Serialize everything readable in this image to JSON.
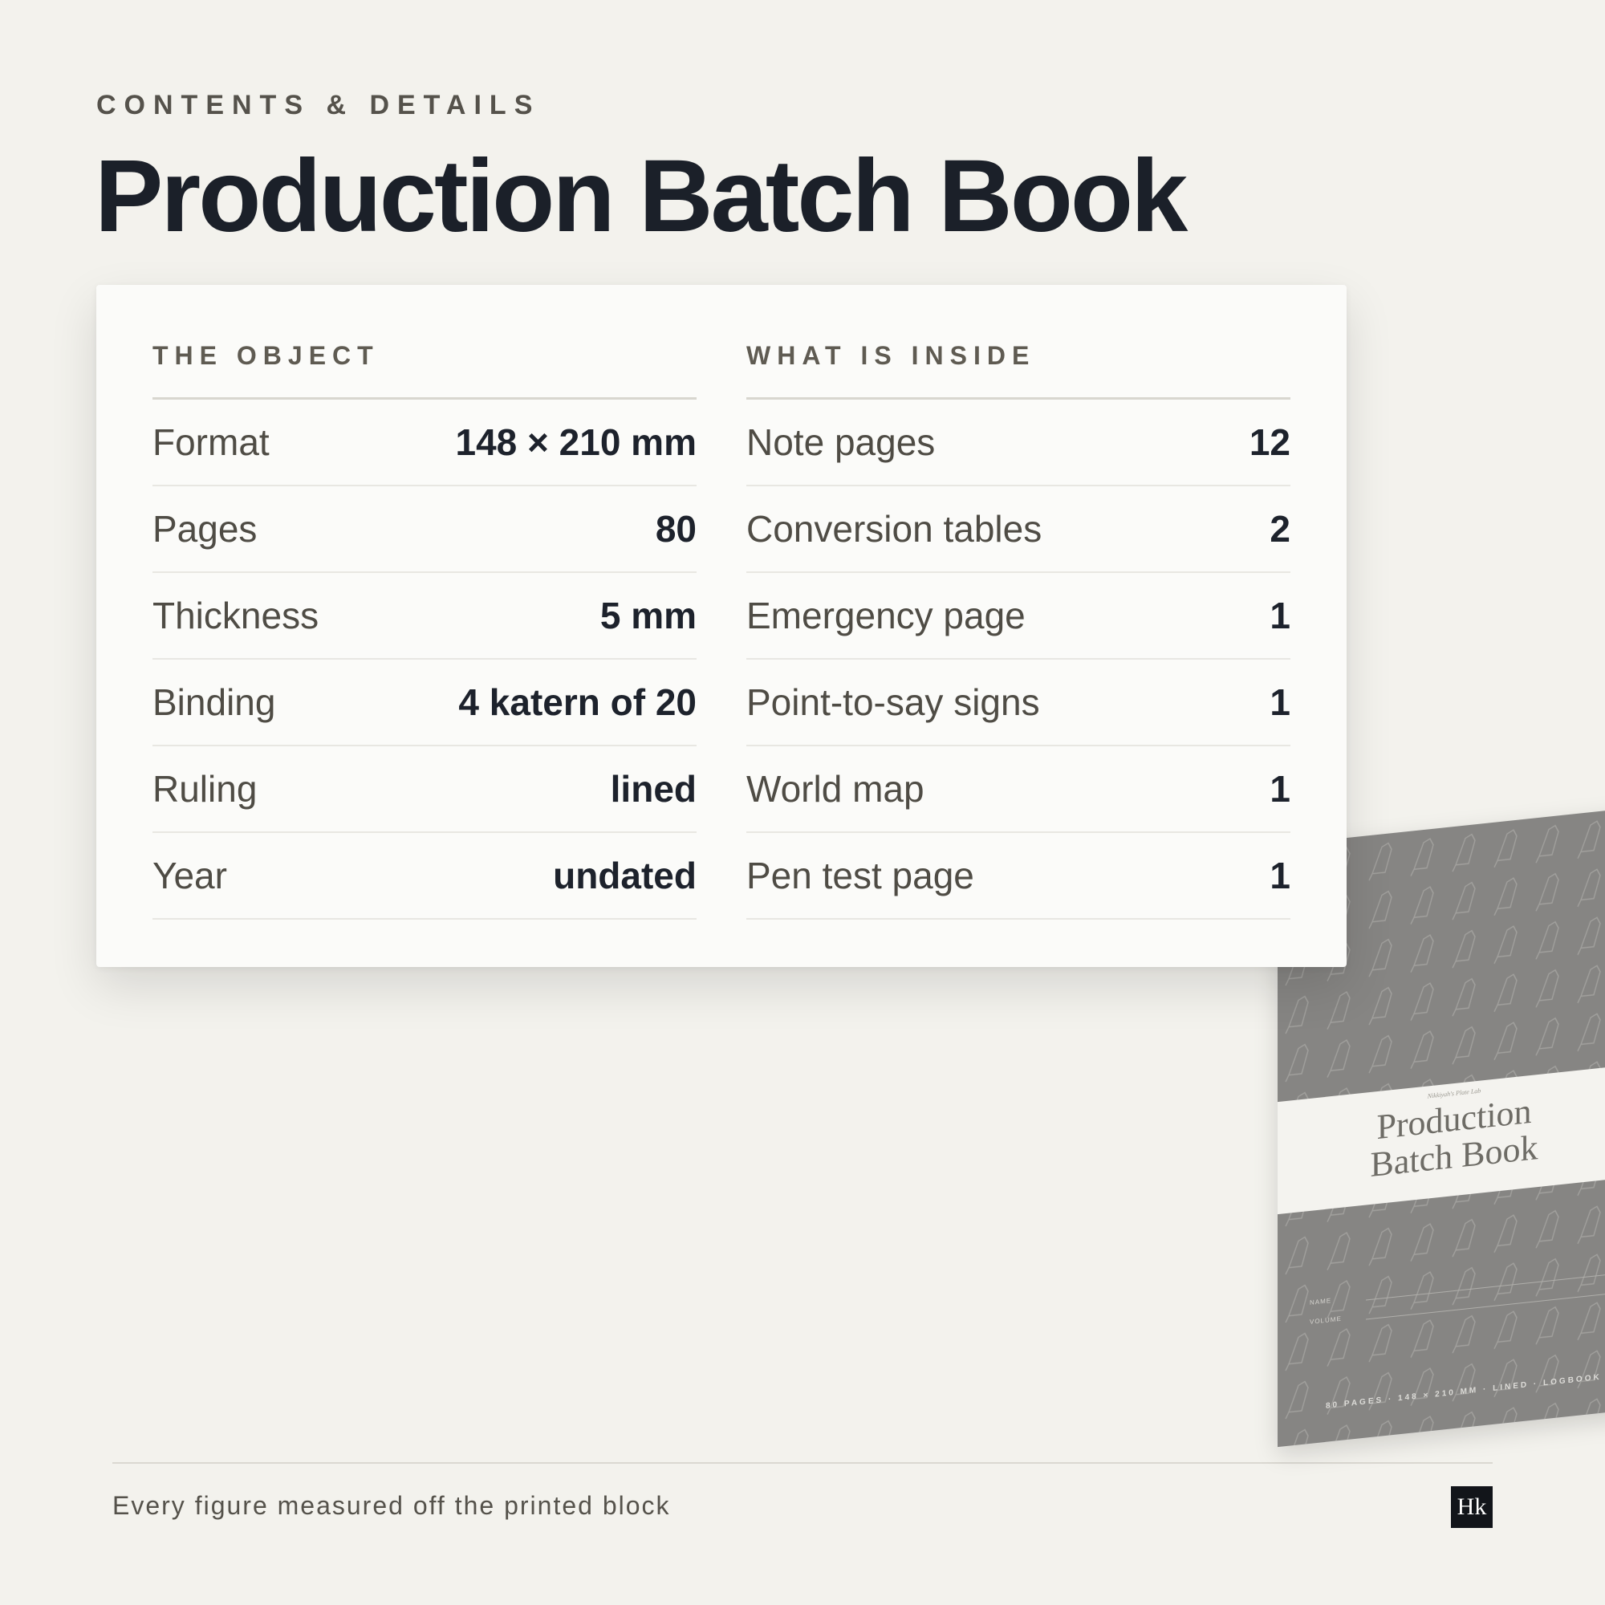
{
  "header": {
    "eyebrow": "CONTENTS & DETAILS",
    "title": "Production Batch Book"
  },
  "object_section": {
    "heading": "THE OBJECT",
    "rows": [
      {
        "label": "Format",
        "value": "148 × 210 mm"
      },
      {
        "label": "Pages",
        "value": "80"
      },
      {
        "label": "Thickness",
        "value": "5 mm"
      },
      {
        "label": "Binding",
        "value": "4 katern of 20"
      },
      {
        "label": "Ruling",
        "value": "lined"
      },
      {
        "label": "Year",
        "value": "undated"
      }
    ]
  },
  "inside_section": {
    "heading": "WHAT IS INSIDE",
    "rows": [
      {
        "label": "Note pages",
        "value": "12"
      },
      {
        "label": "Conversion tables",
        "value": "2"
      },
      {
        "label": "Emergency page",
        "value": "1"
      },
      {
        "label": "Point-to-say signs",
        "value": "1"
      },
      {
        "label": "World map",
        "value": "1"
      },
      {
        "label": "Pen test page",
        "value": "1"
      }
    ]
  },
  "cover": {
    "publisher": "Nikkiyah's Plate Lab",
    "title_line1": "Production",
    "title_line2": "Batch Book",
    "name_label": "NAME",
    "volume_label": "VOLUME",
    "spec_line": "80 PAGES · 148 × 210 MM · LINED · LOGBOOK",
    "color": "#868583",
    "pattern_icon": "pipette-icon"
  },
  "footer": {
    "note": "Every figure measured off the printed block",
    "logo_text": "Hk"
  },
  "colors": {
    "background": "#f3f2ed",
    "card": "#fbfbf9",
    "ink": "#1d222c",
    "muted": "#55524b"
  }
}
